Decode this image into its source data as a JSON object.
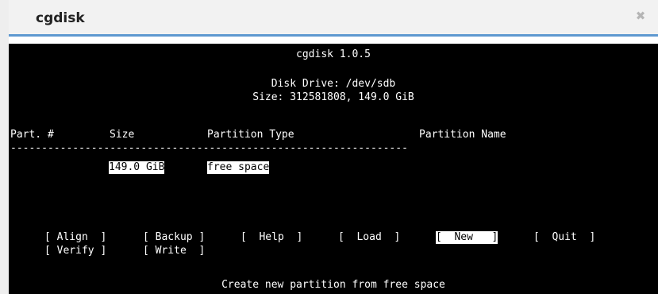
{
  "window": {
    "title": "cgdisk",
    "close_icon": "close-icon"
  },
  "app": {
    "version_line": "cgdisk 1.0.5",
    "disk_line": "Disk Drive: /dev/sdb",
    "size_line": "Size: 312581808, 149.0 GiB"
  },
  "table": {
    "headers": {
      "part": "Part. #",
      "size": "Size",
      "type": "Partition Type",
      "name": "Partition Name"
    },
    "separator": "----------------------------------------------------------------",
    "rows": [
      {
        "part": "",
        "size": "149.0 GiB",
        "type": "free space",
        "name": ""
      }
    ]
  },
  "menu": {
    "items": [
      {
        "label": "[ Align  ]"
      },
      {
        "label": "[ Backup ]"
      },
      {
        "label": "[  Help  ]"
      },
      {
        "label": "[  Load  ]"
      },
      {
        "label": "[  New   ]",
        "selected": true
      },
      {
        "label": "[  Quit  ]"
      },
      {
        "label": "[ Verify ]"
      },
      {
        "label": "[ Write  ]"
      }
    ]
  },
  "status": "Create new partition from free space",
  "colors": {
    "terminal_bg": "#000000",
    "terminal_fg": "#ffffff",
    "accent_border": "#5e98d0",
    "titlebar_bg": "#f2f2f2"
  }
}
